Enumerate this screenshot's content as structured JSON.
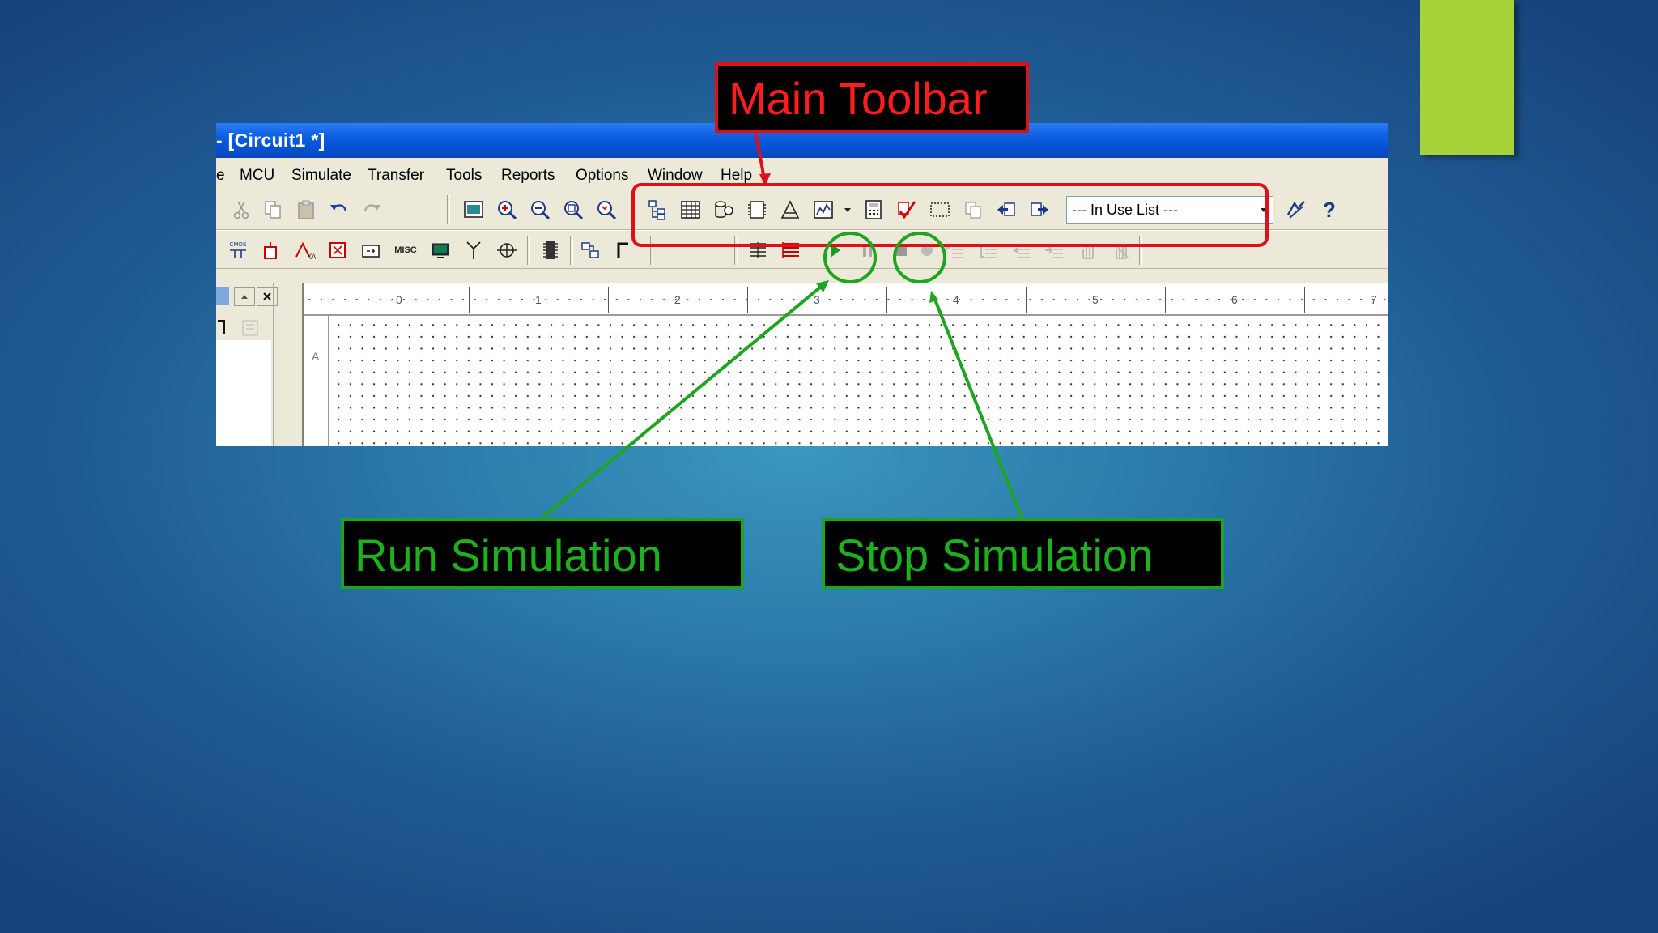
{
  "window": {
    "title": "- [Circuit1 *]"
  },
  "menu": [
    "e",
    "MCU",
    "Simulate",
    "Transfer",
    "Tools",
    "Reports",
    "Options",
    "Window",
    "Help"
  ],
  "toolbar": {
    "component_combo_value": "--- In Use List ---",
    "misc_label": "MISC",
    "cmos_label": "CMOS"
  },
  "ruler": {
    "ticks": [
      "0",
      "1",
      "2",
      "3",
      "4",
      "5",
      "6",
      "7"
    ],
    "row_label": "A"
  },
  "callouts": {
    "main_toolbar": "Main Toolbar",
    "run_simulation": "Run Simulation",
    "stop_simulation": "Stop Simulation"
  },
  "colors": {
    "red_callout": "#e0101a",
    "green_callout": "#1ea51e",
    "accent": "#a6d23a",
    "titlebar": "#0650d0"
  }
}
